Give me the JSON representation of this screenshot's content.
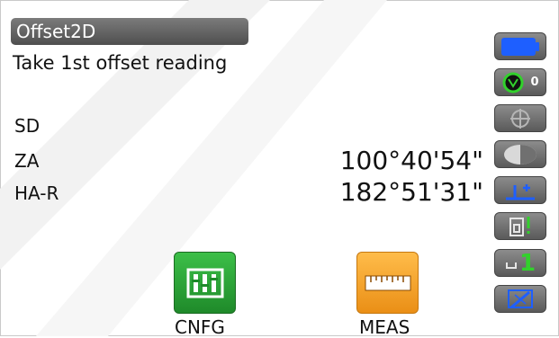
{
  "screen": {
    "title": "Offset2D",
    "instruction": "Take 1st offset reading"
  },
  "measurements": [
    {
      "label": "SD",
      "value": ""
    },
    {
      "label": "ZA",
      "value": "100°40'54\""
    },
    {
      "label": "HA-R",
      "value": "182°51'31\""
    }
  ],
  "side_panel": {
    "icons": [
      "battery-icon",
      "target-icon",
      "tilt-icon",
      "face-icon",
      "height-icon",
      "edm-icon",
      "level-icon",
      "edit-icon"
    ],
    "target_count": "0",
    "level_value": "1"
  },
  "softkeys": [
    {
      "label": "CNFG",
      "color": "#2e9e3a"
    },
    {
      "label": "MEAS",
      "color": "#f0a22a"
    }
  ],
  "colors": {
    "battery": "#1e5fff",
    "green": "#32d12c",
    "blue": "#1e5fff"
  }
}
